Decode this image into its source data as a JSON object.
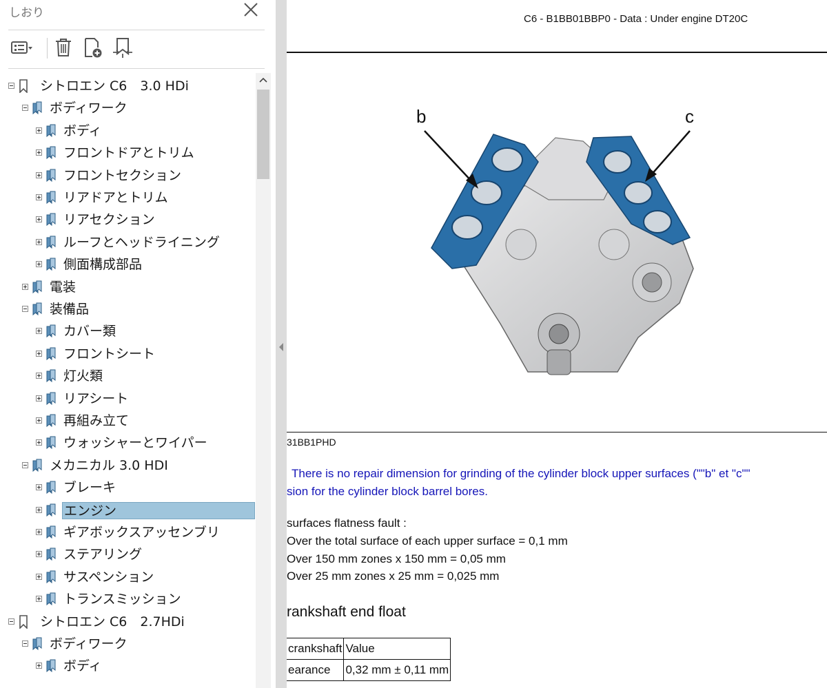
{
  "panel": {
    "title": "しおり",
    "tree": [
      {
        "label": "シトロエン C6　3.0 HDi",
        "level": 0,
        "expanded": true,
        "icon": "bookmark-outline-icon"
      },
      {
        "label": "ボディワーク",
        "level": 1,
        "expanded": true,
        "icon": "bookmark-stack-icon"
      },
      {
        "label": "ボディ",
        "level": 2,
        "expanded": false,
        "icon": "bookmark-stack-icon"
      },
      {
        "label": "フロントドアとトリム",
        "level": 2,
        "expanded": false,
        "icon": "bookmark-stack-icon"
      },
      {
        "label": "フロントセクション",
        "level": 2,
        "expanded": false,
        "icon": "bookmark-stack-icon"
      },
      {
        "label": "リアドアとトリム",
        "level": 2,
        "expanded": false,
        "icon": "bookmark-stack-icon"
      },
      {
        "label": "リアセクション",
        "level": 2,
        "expanded": false,
        "icon": "bookmark-stack-icon"
      },
      {
        "label": "ルーフとヘッドライニング",
        "level": 2,
        "expanded": false,
        "icon": "bookmark-stack-icon"
      },
      {
        "label": "側面構成部品",
        "level": 2,
        "expanded": false,
        "icon": "bookmark-stack-icon"
      },
      {
        "label": "電装",
        "level": 1,
        "expanded": false,
        "icon": "bookmark-stack-icon"
      },
      {
        "label": "装備品",
        "level": 1,
        "expanded": true,
        "icon": "bookmark-stack-icon"
      },
      {
        "label": "カバー類",
        "level": 2,
        "expanded": false,
        "icon": "bookmark-stack-icon"
      },
      {
        "label": "フロントシート",
        "level": 2,
        "expanded": false,
        "icon": "bookmark-stack-icon"
      },
      {
        "label": "灯火類",
        "level": 2,
        "expanded": false,
        "icon": "bookmark-stack-icon"
      },
      {
        "label": "リアシート",
        "level": 2,
        "expanded": false,
        "icon": "bookmark-stack-icon"
      },
      {
        "label": "再組み立て",
        "level": 2,
        "expanded": false,
        "icon": "bookmark-stack-icon"
      },
      {
        "label": "ウォッシャーとワイパー",
        "level": 2,
        "expanded": false,
        "icon": "bookmark-stack-icon"
      },
      {
        "label": "メカニカル 3.0 HDI",
        "level": 1,
        "expanded": true,
        "icon": "bookmark-stack-icon"
      },
      {
        "label": "ブレーキ",
        "level": 2,
        "expanded": false,
        "icon": "bookmark-stack-icon"
      },
      {
        "label": "エンジン",
        "level": 2,
        "expanded": false,
        "icon": "bookmark-stack-icon",
        "selected": true
      },
      {
        "label": "ギアボックスアッセンブリ",
        "level": 2,
        "expanded": false,
        "icon": "bookmark-stack-icon"
      },
      {
        "label": "ステアリング",
        "level": 2,
        "expanded": false,
        "icon": "bookmark-stack-icon"
      },
      {
        "label": "サスペンション",
        "level": 2,
        "expanded": false,
        "icon": "bookmark-stack-icon"
      },
      {
        "label": "トランスミッション",
        "level": 2,
        "expanded": false,
        "icon": "bookmark-stack-icon"
      },
      {
        "label": "シトロエン C6　2.7HDi",
        "level": 0,
        "expanded": true,
        "icon": "bookmark-outline-icon"
      },
      {
        "label": "ボディワーク",
        "level": 1,
        "expanded": true,
        "icon": "bookmark-stack-icon"
      },
      {
        "label": "ボディ",
        "level": 2,
        "expanded": false,
        "icon": "bookmark-stack-icon"
      }
    ]
  },
  "document": {
    "header": "C6 - B1BB01BBP0 - Data : Under engine DT20C",
    "figure": {
      "label_b": "b",
      "label_c": "c"
    },
    "figure_ref": "31BB1PHD",
    "note_line1": "There is no repair dimension for grinding of the cylinder block upper surfaces (\"\"b\" et \"c\"\"",
    "note_line2": "sion for the cylinder block barrel bores.",
    "flatness_title": "surfaces flatness fault :",
    "flatness_items": [
      "Over the total surface of each upper surface = 0,1 mm",
      "Over 150 mm zones x 150 mm = 0,05 mm",
      "Over 25 mm zones x 25 mm = 0,025 mm"
    ],
    "section_title": "rankshaft end float",
    "table": {
      "headers": [
        "crankshaft",
        "Value"
      ],
      "rows": [
        [
          "earance",
          "0,32 mm ± 0,11 mm"
        ]
      ]
    }
  }
}
